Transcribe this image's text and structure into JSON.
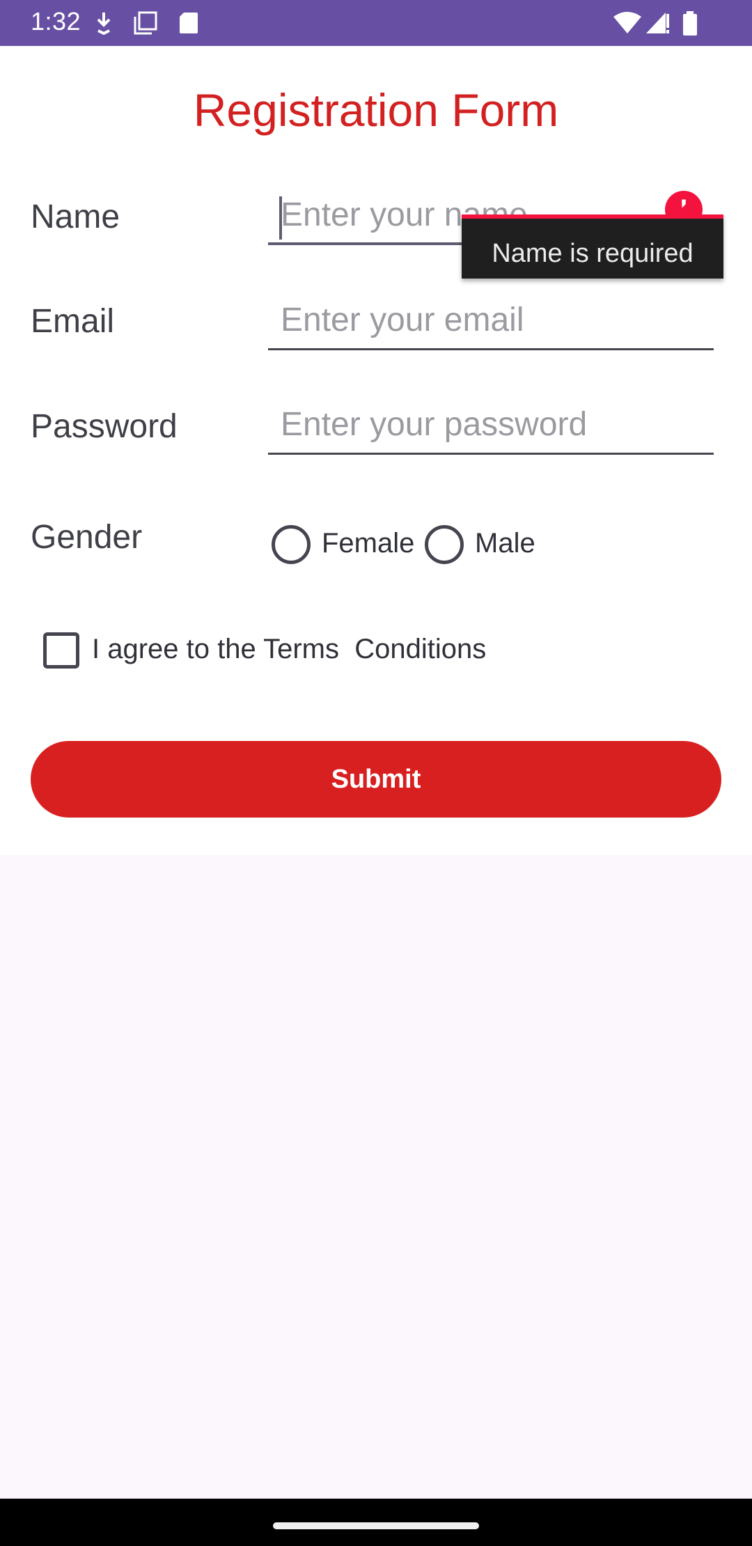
{
  "status_bar": {
    "time": "1:32",
    "icons": [
      "download-icon",
      "copy-icon",
      "sd-card-icon",
      "wifi-icon",
      "signal-icon",
      "battery-icon"
    ]
  },
  "form": {
    "title": "Registration Form",
    "name": {
      "label": "Name",
      "placeholder": "Enter your name",
      "value": ""
    },
    "email": {
      "label": "Email",
      "placeholder": "Enter your email",
      "value": ""
    },
    "password": {
      "label": "Password",
      "placeholder": "Enter your password",
      "value": ""
    },
    "gender": {
      "label": "Gender",
      "options": [
        "Female",
        "Male"
      ],
      "selected": null
    },
    "terms": {
      "label": "I agree to the Terms  Conditions",
      "checked": false
    },
    "submit_label": "Submit",
    "error": {
      "message": "Name is required",
      "icon": "error-icon"
    }
  },
  "colors": {
    "status_bar": "#6750a4",
    "accent_red": "#d82020",
    "error_red": "#f4133e",
    "background": "#fcf6fd"
  }
}
